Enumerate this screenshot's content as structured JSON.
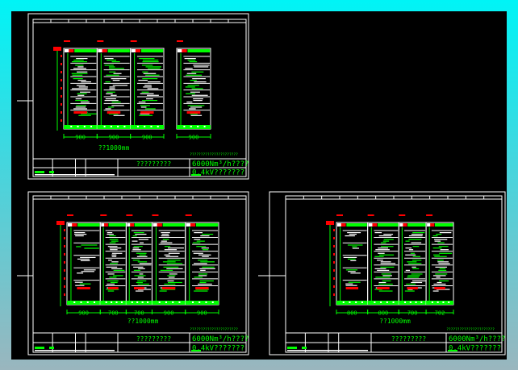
{
  "colors": {
    "background": "#000000",
    "frame": "#ffffff",
    "green": "#00ff00",
    "red": "#ff0000",
    "viewport_border": "#00f4f6"
  },
  "sheets": [
    {
      "panels": [
        900,
        900,
        900,
        900
      ],
      "panel_gap_after": 2,
      "dim_labels": [
        "900",
        "900",
        "900",
        "900"
      ],
      "total_label": "??1000mm",
      "note": "??????????????????????",
      "title_center": "?????????",
      "title_right_1": "6000Nm³/h????",
      "title_right_2": "0.4kV???????"
    },
    {
      "panels": [
        900,
        700,
        700,
        900,
        900
      ],
      "panel_gap_after": -1,
      "dim_labels": [
        "900",
        "700",
        "700",
        "900",
        "900"
      ],
      "total_label": "??1000mm",
      "note": "??????????????????????",
      "title_center": "?????????",
      "title_right_1": "6000Nm³/h????",
      "title_right_2": "0.4kV???????"
    },
    {
      "panels": [
        800,
        800,
        700,
        702
      ],
      "panel_gap_after": -1,
      "dim_labels": [
        "800",
        "800",
        "700",
        "702"
      ],
      "total_label": "??1000mm",
      "note": "??????????????????????",
      "title_center": "?????????",
      "title_right_1": "6000Nm³/h????",
      "title_right_2": "0.4kV???????"
    }
  ]
}
